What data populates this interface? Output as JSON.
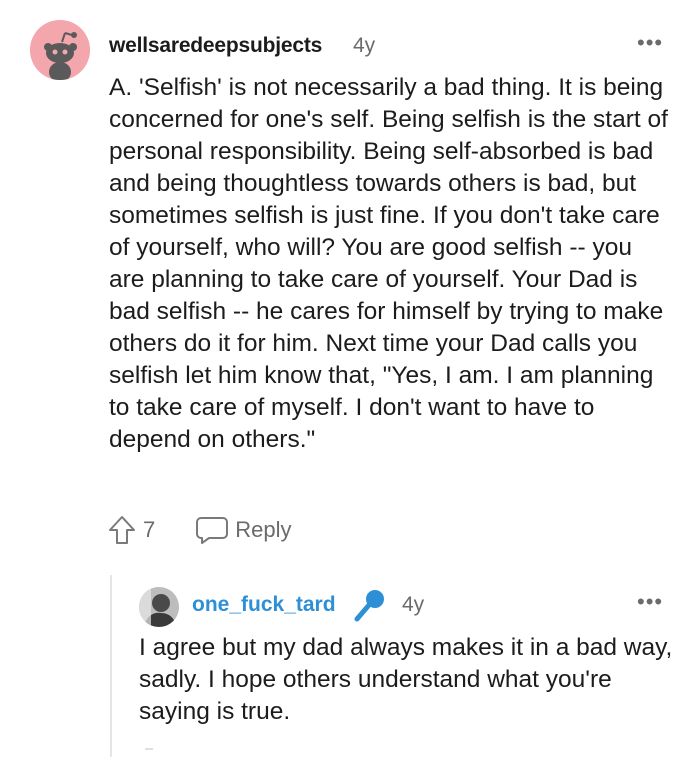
{
  "comment": {
    "username": "wellsaredeepsubjects",
    "age": "4y",
    "more_label": "•••",
    "body": "A. 'Selfish' is not necessarily a bad thing. It is being concerned for one's self. Being selfish is the start of personal responsibility. Being self-absorbed is bad and being thoughtless towards others is bad, but sometimes selfish is just fine. If you don't take care of yourself, who will? You are good selfish -- you are planning to take care of yourself. Your Dad is bad selfish -- he cares for himself by trying to make others do it for him. Next time your Dad calls you selfish let him know that, \"Yes, I am. I am planning to take care of myself. I don't want to have to depend on others.\"",
    "vote_count": "7",
    "reply_label": "Reply",
    "avatar_color": "#f4a6ad"
  },
  "reply": {
    "username": "one_fuck_tard",
    "age": "4y",
    "more_label": "•••",
    "body": "I agree but my dad always makes it in a bad way, sadly. I hope others understand what you're saying is true.",
    "username_color": "#2d8fd5",
    "badge_icon": "microphone-icon"
  },
  "icons": {
    "upvote": "upvote-arrow-icon",
    "reply": "speech-bubble-icon"
  }
}
